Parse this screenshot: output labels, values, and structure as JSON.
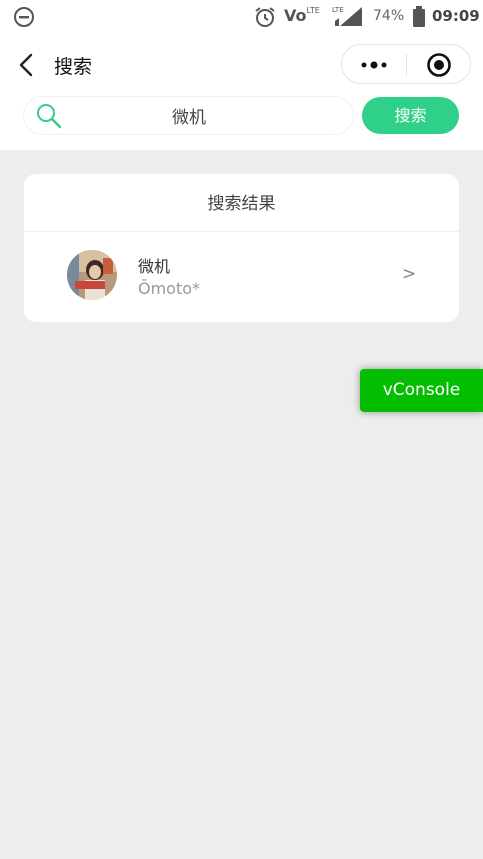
{
  "status_bar": {
    "time": "09:09",
    "battery": "74%",
    "volte_label": "Vo",
    "lte_label": "LTE",
    "icons": [
      "do-not-disturb-icon",
      "alarm-icon",
      "volte-icon",
      "signal-icon",
      "battery-icon"
    ]
  },
  "navbar": {
    "title": "搜索",
    "icons": [
      "back-icon",
      "more-icon",
      "target-icon"
    ]
  },
  "search": {
    "value": "微机",
    "button_label": "搜索",
    "accent_color": "#2fd087"
  },
  "results": {
    "header": "搜索结果",
    "items": [
      {
        "name": "微机",
        "subtitle": "Ōmoto*",
        "chevron": ">"
      }
    ]
  },
  "vconsole": {
    "label": "vConsole",
    "color": "#04be02"
  }
}
